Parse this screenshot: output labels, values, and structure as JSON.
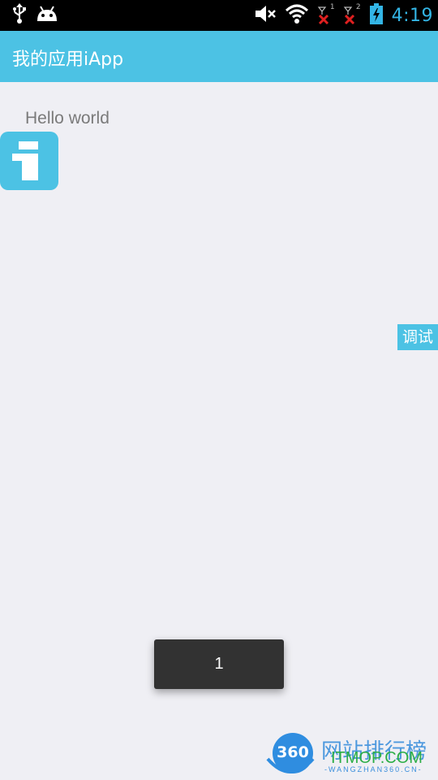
{
  "status_bar": {
    "time": "4:19",
    "sim1_label": "1",
    "sim2_label": "2",
    "icons": [
      "usb-icon",
      "android-icon",
      "mute-icon",
      "wifi-icon",
      "sim1-no-signal-icon",
      "sim2-no-signal-icon",
      "battery-charging-icon"
    ]
  },
  "app_bar": {
    "title": "我的应用iApp",
    "color": "#4cc2e4"
  },
  "main": {
    "hello_text": "Hello world",
    "floating_logo_icon": "iapp-logo-icon",
    "debug_tab_label": "调试"
  },
  "toast": {
    "text": "1"
  },
  "watermark": {
    "badge": "360",
    "chinese_text": "网站排行榜",
    "brand": "ITMOP.COM",
    "url_text": "-WANGZHAN360.CN-"
  },
  "colors": {
    "accent": "#4cc2e4",
    "status_bar": "#000000",
    "background": "#efeff4",
    "clock": "#33b5e5",
    "toast": "#323232"
  }
}
